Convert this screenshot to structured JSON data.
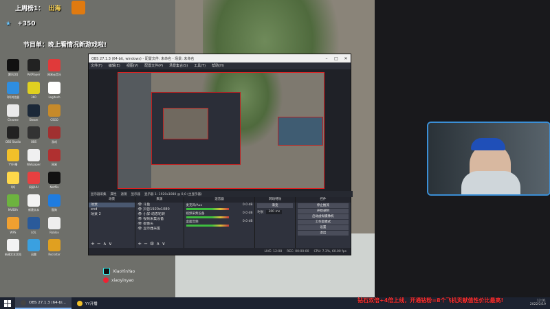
{
  "overlay": {
    "rank_text": "上周榜1：",
    "rank_name": "出海",
    "gain": "+350",
    "program_label": "节目单：",
    "program_text": "晚上看情况新游戏啦!",
    "ticker": "钻石双倍+4倍上线，开通钻粉=8个飞机贡献值性价比最高!",
    "douyin_id": "XiaoYinYao",
    "weibo_id": "xiaoyinyao"
  },
  "desktop_icons": [
    {
      "label": "腾讯QQ",
      "color": "#111111"
    },
    {
      "label": "PotPlayer",
      "color": "#222222"
    },
    {
      "label": "网易云音乐",
      "color": "#e03a3a"
    },
    {
      "label": "QQ浏览器",
      "color": "#2f8ee0"
    },
    {
      "label": "360",
      "color": "#e0d020"
    },
    {
      "label": "Logitech",
      "color": "#ffffff"
    },
    {
      "label": "Chrome",
      "color": "#eaeaea"
    },
    {
      "label": "Steam",
      "color": "#1b2838"
    },
    {
      "label": "CSGO",
      "color": "#c68a2a"
    },
    {
      "label": "OBS Studio",
      "color": "#222222"
    },
    {
      "label": "OBS",
      "color": "#333333"
    },
    {
      "label": "游戏",
      "color": "#a03030"
    },
    {
      "label": "YY开播",
      "color": "#f1c02a"
    },
    {
      "label": "Wallpaper",
      "color": "#f0f0f0"
    },
    {
      "label": "网易",
      "color": "#b03030"
    },
    {
      "label": "QQ",
      "color": "#ffd84a"
    },
    {
      "label": "网易UU",
      "color": "#e84040"
    },
    {
      "label": "Netflix",
      "color": "#111111"
    },
    {
      "label": "NVIDIA",
      "color": "#6db33f"
    },
    {
      "label": "新建文本",
      "color": "#f3f3f3"
    },
    {
      "label": "酷狗",
      "color": "#1f7ce0"
    },
    {
      "label": "WPS",
      "color": "#f0a030"
    },
    {
      "label": "LOL",
      "color": "#2a5a9a"
    },
    {
      "label": "Roblox",
      "color": "#eeeeee"
    },
    {
      "label": "新建文本文档",
      "color": "#f3f3f3"
    },
    {
      "label": "迅雷",
      "color": "#3aa0e0"
    },
    {
      "label": "Rockstar",
      "color": "#e0a020"
    }
  ],
  "obs": {
    "title": "OBS 27.1.3 (64-bit, windows) - 配置文件: 未命名 - 场景: 未命名",
    "menu": [
      "文件(F)",
      "编辑(E)",
      "视图(V)",
      "配置文件(P)",
      "场景集合(S)",
      "工具(T)",
      "帮助(H)"
    ],
    "status_strip": [
      "显示器采集",
      "属性",
      "滤镜",
      "显示器",
      "显示器 1: 1920x1080 @ 0,0 (主显示器)"
    ],
    "docks": {
      "scenes": {
        "title": "场景",
        "items": [
          "场景",
          "end",
          "场景 2"
        ],
        "selected": 0
      },
      "sources": {
        "title": "来源",
        "items": [
          "斗鱼",
          "抖音1920x1080",
          "小屏-动态轮转",
          "视频采集设备",
          "摄像头",
          "显示器采集"
        ]
      },
      "mixer": {
        "title": "混音器",
        "rows": [
          {
            "name": "麦克风/Aux",
            "db": "0.0 dB"
          },
          {
            "name": "视频采集设备",
            "db": "0.0 dB"
          },
          {
            "name": "桌面音频",
            "db": "0.0 dB"
          }
        ]
      },
      "transitions": {
        "title": "转场特效",
        "mode": "渐变",
        "duration_label": "时长",
        "duration": "300 ms"
      },
      "controls": {
        "title": "控件",
        "buttons": [
          "停止推流",
          "开始录制",
          "启动虚拟摄像机",
          "工作室模式",
          "设置",
          "退出"
        ]
      }
    },
    "statusbar": [
      "LIVE: 12:08",
      "REC: 00:00:00",
      "CPU: 7.3%, 60.00 fps"
    ]
  },
  "taskbar": {
    "items": [
      {
        "label": "OBS 27.1.3 (64-bi...",
        "active": true,
        "color": "#444"
      },
      {
        "label": "YY开播",
        "active": false,
        "color": "#f1c02a"
      }
    ],
    "time": "12:01",
    "date": "2022/2/19"
  }
}
